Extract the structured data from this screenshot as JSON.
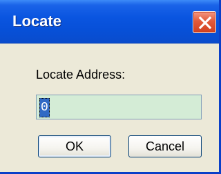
{
  "window": {
    "title": "Locate"
  },
  "dialog": {
    "label": "Locate Address:",
    "address_value": "0",
    "ok_label": "OK",
    "cancel_label": "Cancel"
  },
  "icons": {
    "close": "close-icon"
  },
  "colors": {
    "titlebar": "#0a55e0",
    "close_button": "#e25a3a",
    "dialog_background": "#ece9d8",
    "input_background": "#d4ecd6",
    "selection": "#316ac5"
  }
}
